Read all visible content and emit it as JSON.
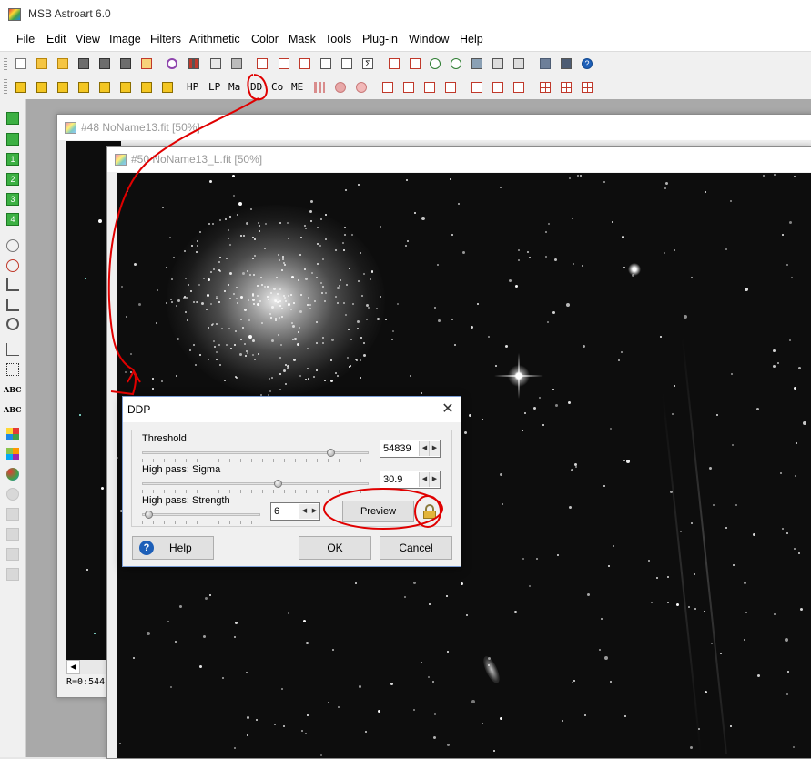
{
  "app": {
    "title": "MSB Astroart 6.0"
  },
  "menu": [
    "File",
    "Edit",
    "View",
    "Image",
    "Filters",
    "Arithmetic",
    "Color",
    "Mask",
    "Tools",
    "Plug-in",
    "Window",
    "Help"
  ],
  "toolbar2": {
    "text_buttons": [
      "HP",
      "LP",
      "Ma",
      "DD",
      "Co",
      "ME"
    ]
  },
  "windows": {
    "back": {
      "title": "#48 NoName13.fit  [50%]",
      "status": "R=0:544"
    },
    "front": {
      "title": "#50 NoName13_L.fit  [50%]"
    }
  },
  "left_toolbar": {
    "labels": [
      "1",
      "2",
      "3",
      "4",
      "ABC",
      "ABC"
    ]
  },
  "dialog": {
    "title": "DDP",
    "close": "✕",
    "threshold": {
      "label": "Threshold",
      "value": "54839",
      "level": 0.83
    },
    "sigma": {
      "label": "High pass: Sigma",
      "value": "30.9",
      "level": 0.6
    },
    "strength": {
      "label": "High pass: Strength",
      "value": "6",
      "level": 0.05
    },
    "preview": "Preview",
    "help": "Help",
    "ok": "OK",
    "cancel": "Cancel"
  },
  "colors": {
    "annotation": "#e00000",
    "sky": "#0d0d0d",
    "dialog_border": "#7a9cd3",
    "help_icon": "#1d5fb8"
  }
}
